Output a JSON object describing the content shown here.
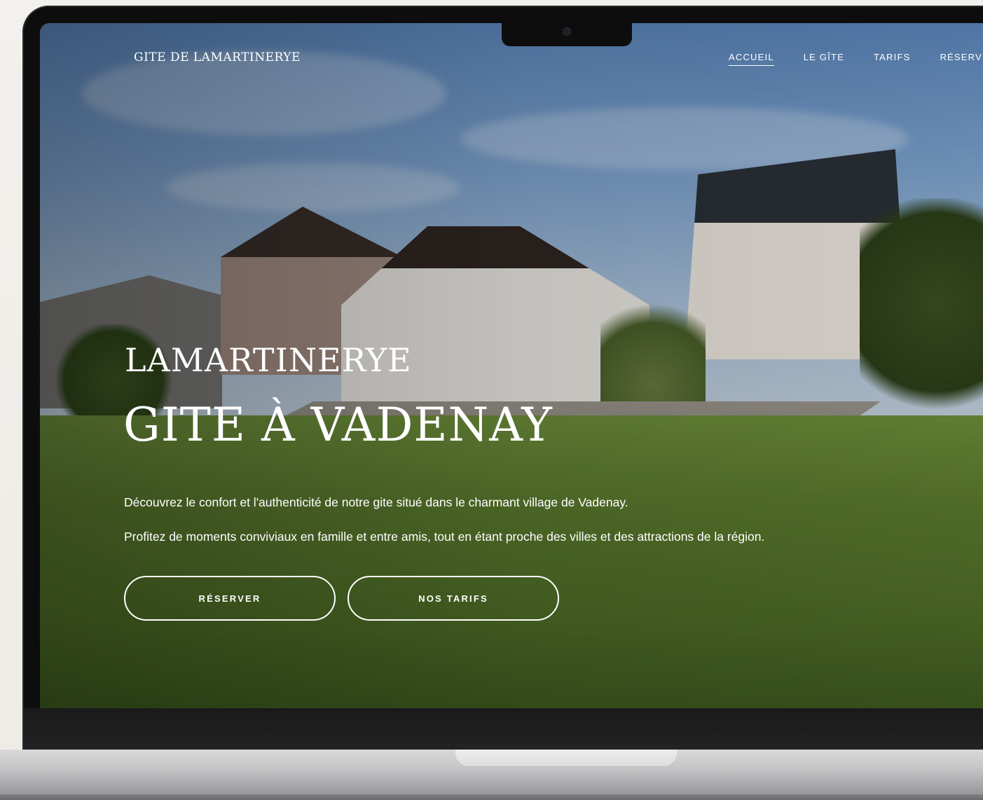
{
  "site": {
    "logo": "GITE DE LAMARTINERYE"
  },
  "nav": {
    "items": [
      {
        "label": "ACCUEIL",
        "active": true
      },
      {
        "label": "LE GÎTE",
        "active": false
      },
      {
        "label": "TARIFS",
        "active": false
      },
      {
        "label": "RÉSERV",
        "active": false
      }
    ]
  },
  "hero": {
    "kicker": "LAMARTINERYE",
    "title": "GITE À VADENAY",
    "text_line_1": "Découvrez le confort et l'authenticité de notre gite situé dans le charmant village de Vadenay.",
    "text_line_2": "Profitez de moments conviviaux en famille et entre amis, tout en étant proche des villes et des attractions de la région.",
    "buttons": {
      "reserve": "RÉSERVER",
      "tarifs": "NOS TARIFS"
    }
  },
  "colors": {
    "sky": "#6b8fbd",
    "grass": "#5a7a2d",
    "text": "#ffffff",
    "laptop_frame": "#0d0d0e"
  }
}
